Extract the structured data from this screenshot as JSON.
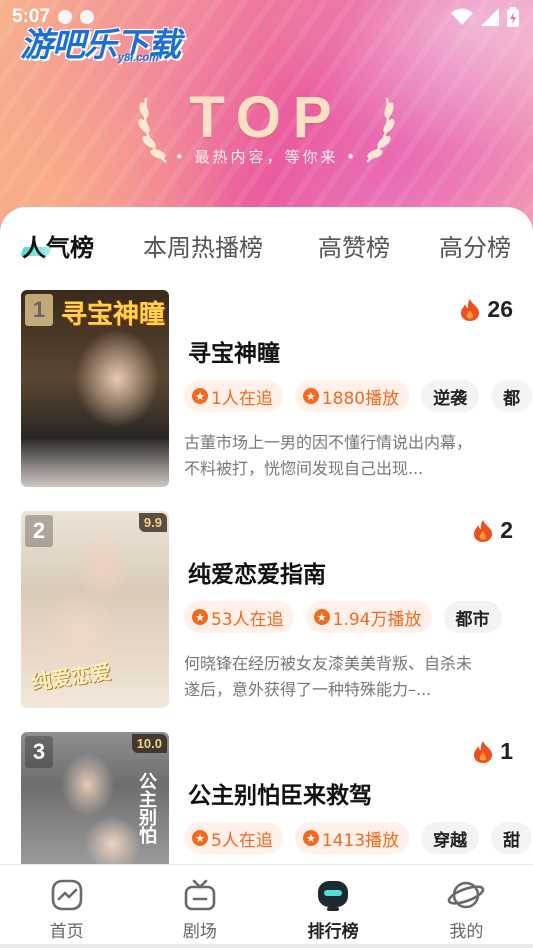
{
  "status_bar": {
    "time": "5:07"
  },
  "header": {
    "site_logo": "游吧乐下载",
    "site_logo_sub": "y8l.com",
    "banner_title": "TOP",
    "banner_subtitle": "• 最热内容，等你来 •"
  },
  "tabs": [
    {
      "label": "人气榜",
      "active": true
    },
    {
      "label": "本周热播榜",
      "active": false
    },
    {
      "label": "高赞榜",
      "active": false
    },
    {
      "label": "高分榜",
      "active": false
    }
  ],
  "list": [
    {
      "rank": "1",
      "rating": "",
      "poster_text": "寻宝神瞳",
      "heat": "26",
      "title": "寻宝神瞳",
      "follow": "1人在追",
      "plays": "1880播放",
      "genres": [
        "逆袭",
        "都"
      ],
      "desc": "古董市场上一男的因不懂行情说出内幕，不料被打，恍惚间发现自己出现..."
    },
    {
      "rank": "2",
      "rating": "9.9",
      "poster_text": "纯爱恋爱",
      "heat": "2",
      "title": "纯爱恋爱指南",
      "follow": "53人在追",
      "plays": "1.94万播放",
      "genres": [
        "都市"
      ],
      "desc": "何晓锋在经历被女友漆美美背叛、自杀未遂后，意外获得了一种特殊能力–..."
    },
    {
      "rank": "3",
      "rating": "10.0",
      "poster_text": "公主别怕",
      "heat": "1",
      "title": "公主别怕臣来救驾",
      "follow": "5人在追",
      "plays": "1413播放",
      "genres": [
        "穿越",
        "甜"
      ],
      "desc": ""
    }
  ],
  "bottom_nav": [
    {
      "label": "首页",
      "icon": "home-chart-icon",
      "active": false
    },
    {
      "label": "剧场",
      "icon": "tv-icon",
      "active": false
    },
    {
      "label": "排行榜",
      "icon": "ranking-icon",
      "active": true
    },
    {
      "label": "我的",
      "icon": "planet-icon",
      "active": false
    }
  ],
  "colors": {
    "accent": "#f26a1f",
    "tab_underline": "#4de0d6",
    "active_nav": "#1f2a30"
  }
}
